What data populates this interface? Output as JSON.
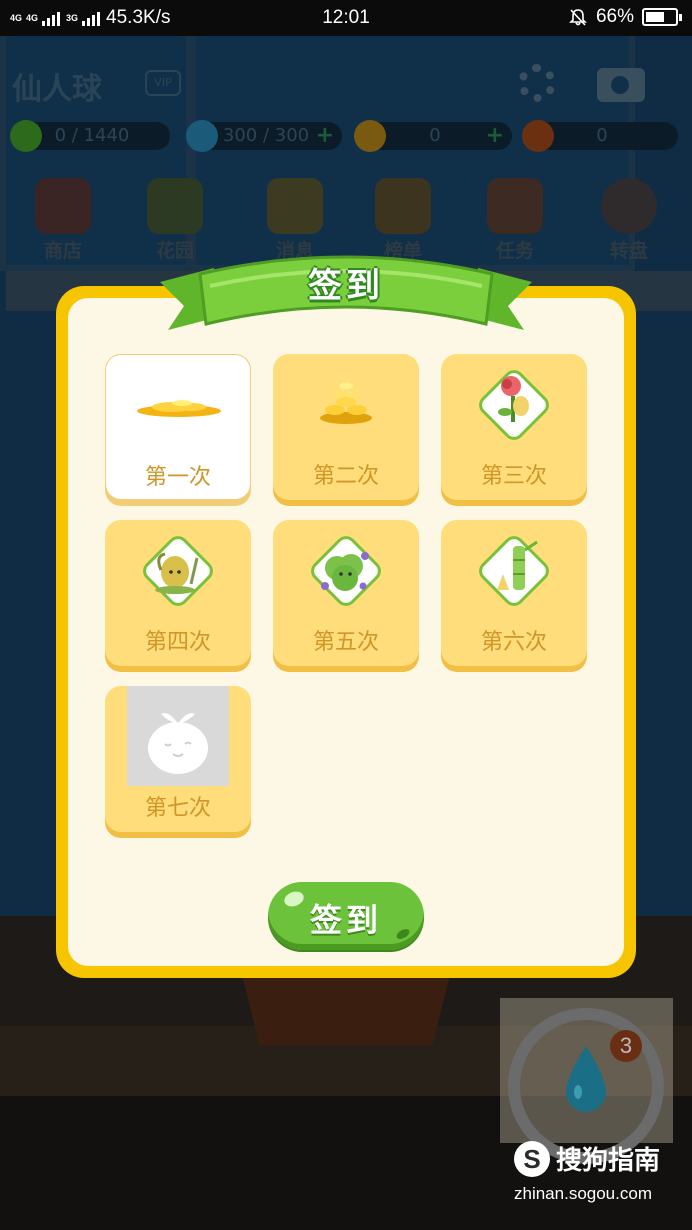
{
  "status_bar": {
    "network_a": "4G",
    "network_b": "4G",
    "network_c": "3G",
    "speed": "45.3K/s",
    "time": "12:01",
    "battery_percent_label": "66%",
    "battery_level": 0.66,
    "icons": [
      "signal-icon",
      "mute-bell-icon",
      "battery-icon"
    ]
  },
  "background": {
    "title": "仙人球",
    "vip": "VIP",
    "resources": [
      {
        "icon": "level-icon",
        "value": "0 / 1440",
        "color": "#2d6a1b"
      },
      {
        "icon": "water-drop-icon",
        "value": "300 / 300",
        "color": "#1c5a7a"
      },
      {
        "icon": "coin-icon",
        "value": "0",
        "color": "#7a5a10"
      },
      {
        "icon": "seed-icon",
        "value": "0",
        "color": "#6a3010"
      }
    ],
    "nav": [
      {
        "label": "商店",
        "icon": "shop-icon"
      },
      {
        "label": "花园",
        "icon": "garden-icon"
      },
      {
        "label": "消息",
        "icon": "message-icon"
      },
      {
        "label": "榜单",
        "icon": "trophy-icon"
      },
      {
        "label": "任务",
        "icon": "balloon-icon"
      },
      {
        "label": "转盘",
        "icon": "wheel-icon"
      }
    ]
  },
  "dialog": {
    "title": "签到",
    "days": [
      {
        "label": "第一次",
        "reward": "coins-small-icon",
        "state": "current"
      },
      {
        "label": "第二次",
        "reward": "coins-pile-icon",
        "state": "pending"
      },
      {
        "label": "第三次",
        "reward": "rose-plant-icon",
        "state": "pending"
      },
      {
        "label": "第四次",
        "reward": "cactus-plant-icon",
        "state": "pending"
      },
      {
        "label": "第五次",
        "reward": "flower-bush-icon",
        "state": "pending"
      },
      {
        "label": "第六次",
        "reward": "bamboo-plant-icon",
        "state": "pending"
      },
      {
        "label": "第七次",
        "reward": "sprout-placeholder-icon",
        "state": "locked"
      }
    ],
    "button_label": "签到",
    "colors": {
      "frame": "#f7c400",
      "inner": "#fdf8e6",
      "card": "#fedd7a",
      "button": "#6cc23a",
      "ribbon": "#7ccf3c"
    }
  },
  "water_widget": {
    "badge": "3"
  },
  "watermark": {
    "brand": "搜狗指南",
    "url": "zhinan.sogou.com"
  }
}
